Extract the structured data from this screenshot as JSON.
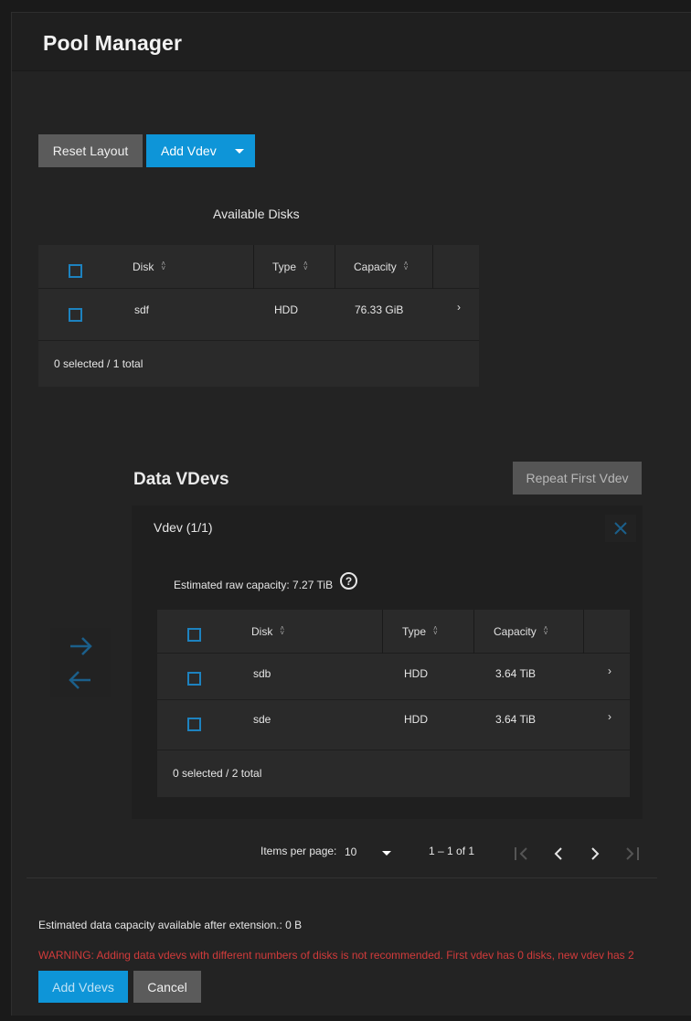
{
  "window": {
    "title": "Pool Manager"
  },
  "toolbar": {
    "reset_label": "Reset Layout",
    "add_vdev_label": "Add Vdev"
  },
  "available": {
    "heading": "Available Disks",
    "columns": [
      "Disk",
      "Type",
      "Capacity"
    ],
    "rows": [
      {
        "disk": "sdf",
        "type": "HDD",
        "capacity": "76.33 GiB"
      }
    ],
    "footer": "0 selected / 1 total"
  },
  "data_vdevs": {
    "heading": "Data VDevs",
    "repeat_label": "Repeat First Vdev",
    "vdev_title": "Vdev (1/1)",
    "raw_capacity": "Estimated raw capacity: 7.27 TiB",
    "help_glyph": "?",
    "columns": [
      "Disk",
      "Type",
      "Capacity"
    ],
    "rows": [
      {
        "disk": "sdb",
        "type": "HDD",
        "capacity": "3.64 TiB"
      },
      {
        "disk": "sde",
        "type": "HDD",
        "capacity": "3.64 TiB"
      }
    ],
    "footer": "0 selected / 2 total"
  },
  "pager": {
    "items_label": "Items per page:",
    "items_value": "10",
    "range": "1 – 1 of 1"
  },
  "bottom": {
    "capacity_note": "Estimated data capacity available after extension.: 0 B",
    "warning": "WARNING: Adding data vdevs with different numbers of disks is not recommended. First vdev has 0 disks, new vdev has 2",
    "add_label": "Add Vdevs",
    "cancel_label": "Cancel"
  },
  "icons": {
    "sort": "sort-icon",
    "checkbox": "checkbox-icon",
    "expand": "chevron-right-icon",
    "close": "close-icon",
    "help": "help-circle-icon",
    "move_right": "arrow-right-icon",
    "move_left": "arrow-left-icon",
    "dropdown": "caret-down-icon",
    "first": "first-page-icon",
    "prev": "chevron-left-icon",
    "next": "chevron-right-icon",
    "last": "last-page-icon"
  },
  "colors": {
    "accent": "#0e95d8",
    "warning": "#d23b3b",
    "checkbox": "#1d82bf",
    "background": "#232323"
  }
}
